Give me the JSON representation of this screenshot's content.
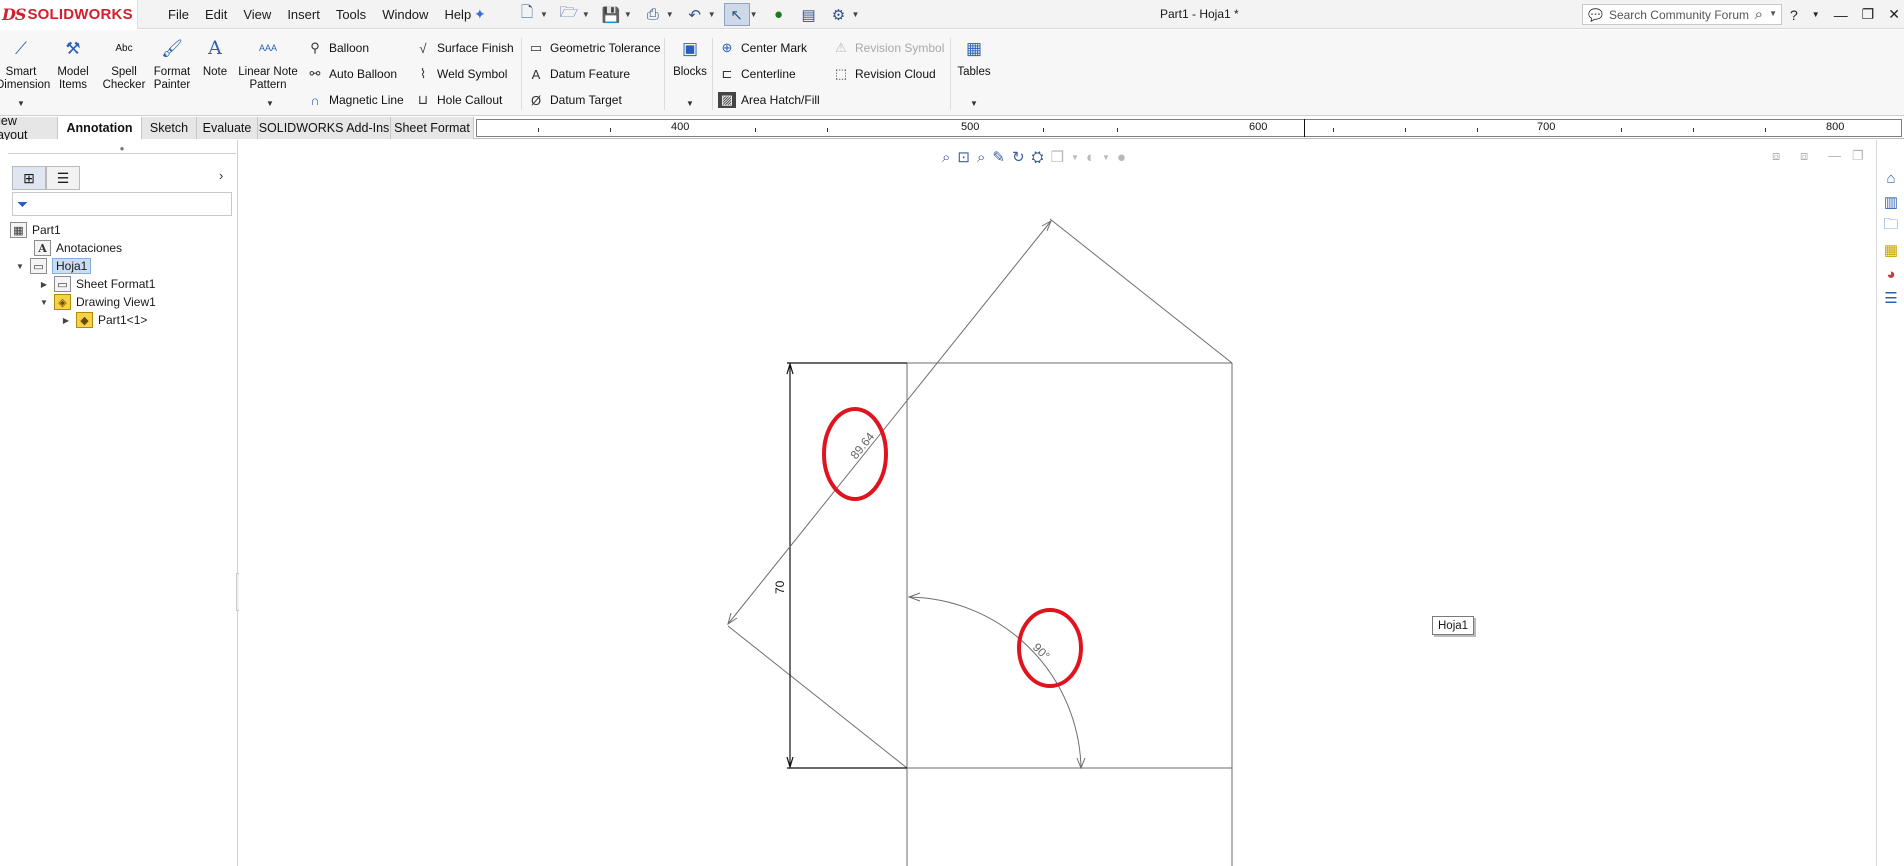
{
  "titlebar": {
    "logo_ds": "DS",
    "logo_word": "SOLIDWORKS",
    "menu": [
      "File",
      "Edit",
      "View",
      "Insert",
      "Tools",
      "Window",
      "Help"
    ],
    "window_title": "Part1 - Hoja1 *",
    "search_placeholder": "Search Community Forum",
    "help_label": "?"
  },
  "ribbon": {
    "smart_dimension": "Smart Dimension",
    "model_items": "Model Items",
    "spell_checker": "Spell Checker",
    "format_painter": "Format Painter",
    "note": "Note",
    "linear_note_pattern": "Linear Note Pattern",
    "balloon": "Balloon",
    "auto_balloon": "Auto Balloon",
    "magnetic_line": "Magnetic Line",
    "surface_finish": "Surface Finish",
    "weld_symbol": "Weld Symbol",
    "hole_callout": "Hole Callout",
    "geometric_tolerance": "Geometric Tolerance",
    "datum_feature": "Datum Feature",
    "datum_target": "Datum Target",
    "blocks": "Blocks",
    "center_mark": "Center Mark",
    "centerline": "Centerline",
    "area_hatch_fill": "Area Hatch/Fill",
    "revision_symbol": "Revision Symbol",
    "revision_cloud": "Revision Cloud",
    "tables": "Tables",
    "spell_icon_text": "Abc",
    "note_icon_text": "A",
    "linear_note_icon_text": "AAA",
    "datum_feature_icon_text": "A",
    "datum_target_icon_text": "Ø"
  },
  "tabs": [
    "View Layout",
    "Annotation",
    "Sketch",
    "Evaluate",
    "SOLIDWORKS Add-Ins",
    "Sheet Format"
  ],
  "active_tab": "Annotation",
  "ruler": {
    "labels": [
      "400",
      "500",
      "600",
      "700",
      "800"
    ]
  },
  "tree": {
    "root": "Part1",
    "annotations": "Anotaciones",
    "sheet": "Hoja1",
    "sheet_format": "Sheet Format1",
    "drawing_view": "Drawing View1",
    "part_instance": "Part1<1>"
  },
  "drawing": {
    "dim_inclined": "89.64",
    "dim_vertical": "70",
    "dim_angle": "90°",
    "highlight_color": "#e0141e",
    "line_color": "#6e6e6e"
  },
  "sheet_tag": "Hoja1",
  "colors": {
    "brand": "#d1202f",
    "accent": "#2b5fb4",
    "selection": "#c9def5"
  }
}
